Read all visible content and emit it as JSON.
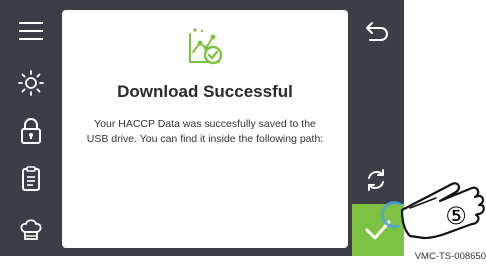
{
  "dialog": {
    "title": "Download Successful",
    "message": "Your HACCP Data was succesfully saved to the USB drive. You can find it inside the following path:"
  },
  "sidebar": {
    "items": [
      {
        "icon": "menu-icon"
      },
      {
        "icon": "brightness-icon"
      },
      {
        "icon": "lock-icon"
      },
      {
        "icon": "document-icon"
      },
      {
        "icon": "chef-hat-icon"
      }
    ]
  },
  "actions": {
    "back_icon": "back-arrow-icon",
    "refresh_icon": "refresh-icon",
    "confirm_icon": "check-icon"
  },
  "annotation": {
    "step": "⑤",
    "doc_ref": "VMC-TS-008650"
  },
  "colors": {
    "screen_bg": "#3b3f45",
    "accent_green": "#7dc242",
    "panel_bg": "#ffffff"
  }
}
